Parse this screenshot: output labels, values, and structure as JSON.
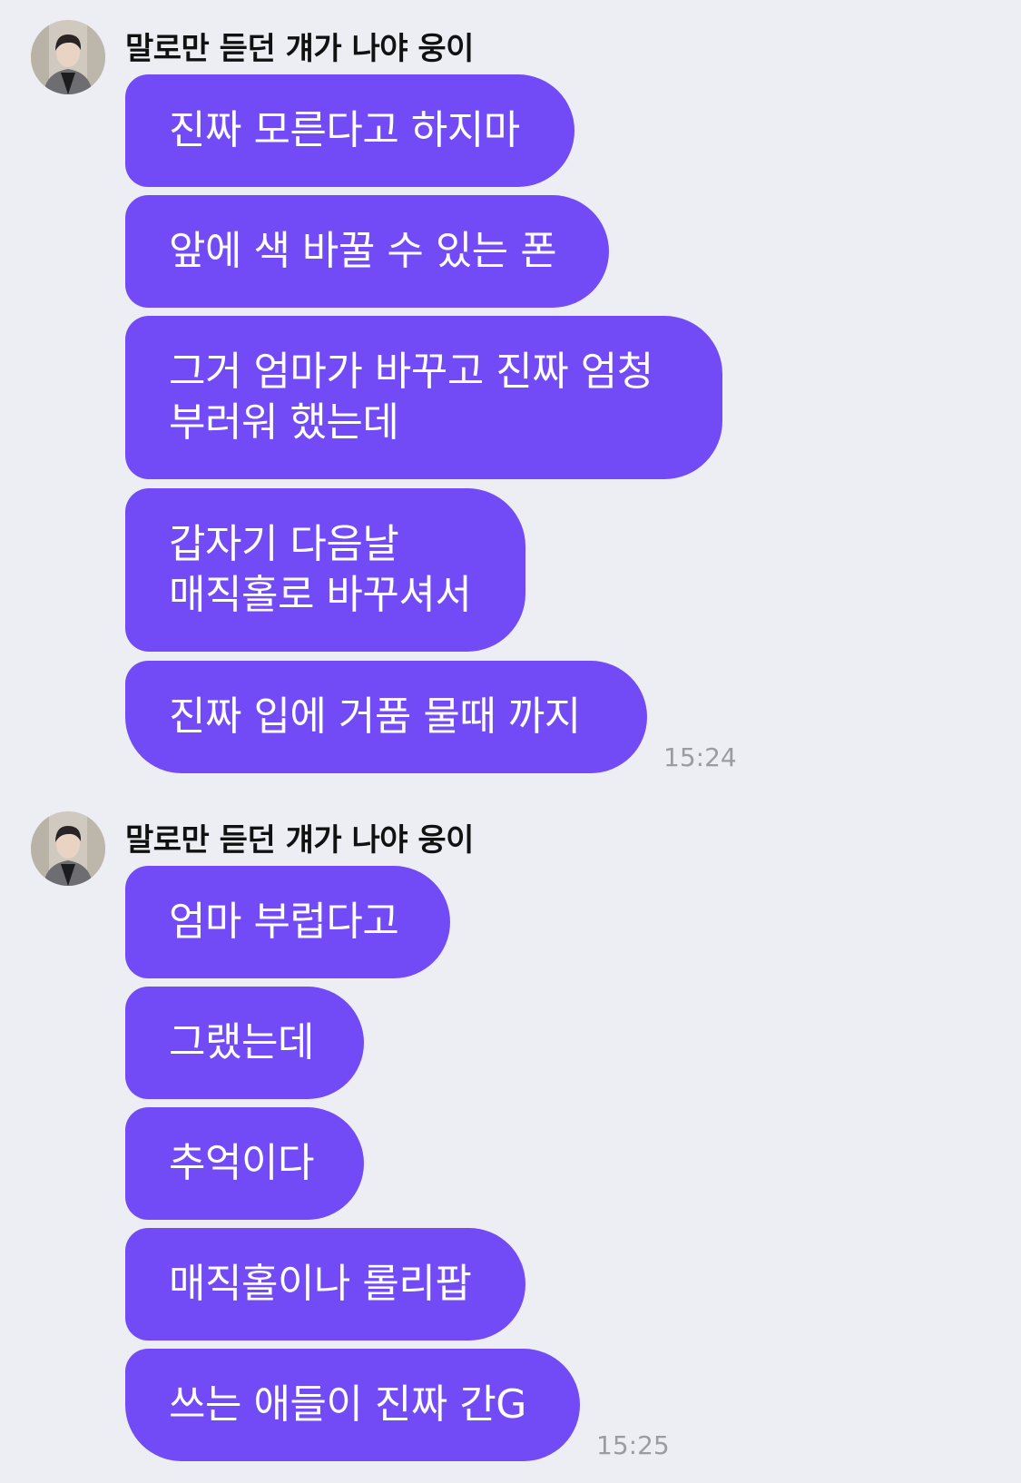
{
  "groups": [
    {
      "sender": "말로만 듣던 걔가 나야 웅이",
      "avatar_icon": "profile-photo",
      "messages": [
        "진짜 모른다고 하지마",
        "앞에 색 바꿀 수 있는 폰",
        "그거 엄마가 바꾸고 진짜 엄청\n부러워 했는데",
        "갑자기 다음날\n매직홀로 바꾸셔서",
        "진짜 입에 거품 물때 까지"
      ],
      "time": "15:24"
    },
    {
      "sender": "말로만 듣던 걔가 나야 웅이",
      "avatar_icon": "profile-photo",
      "messages": [
        "엄마 부럽다고",
        "그랬는데",
        "추억이다",
        "매직홀이나 롤리팝",
        "쓰는 애들이 진짜 간G"
      ],
      "time": "15:25"
    }
  ],
  "colors": {
    "background": "#eceef3",
    "bubble": "#724bf7",
    "bubble_text": "#ffffff",
    "time": "#9a9ca3"
  }
}
